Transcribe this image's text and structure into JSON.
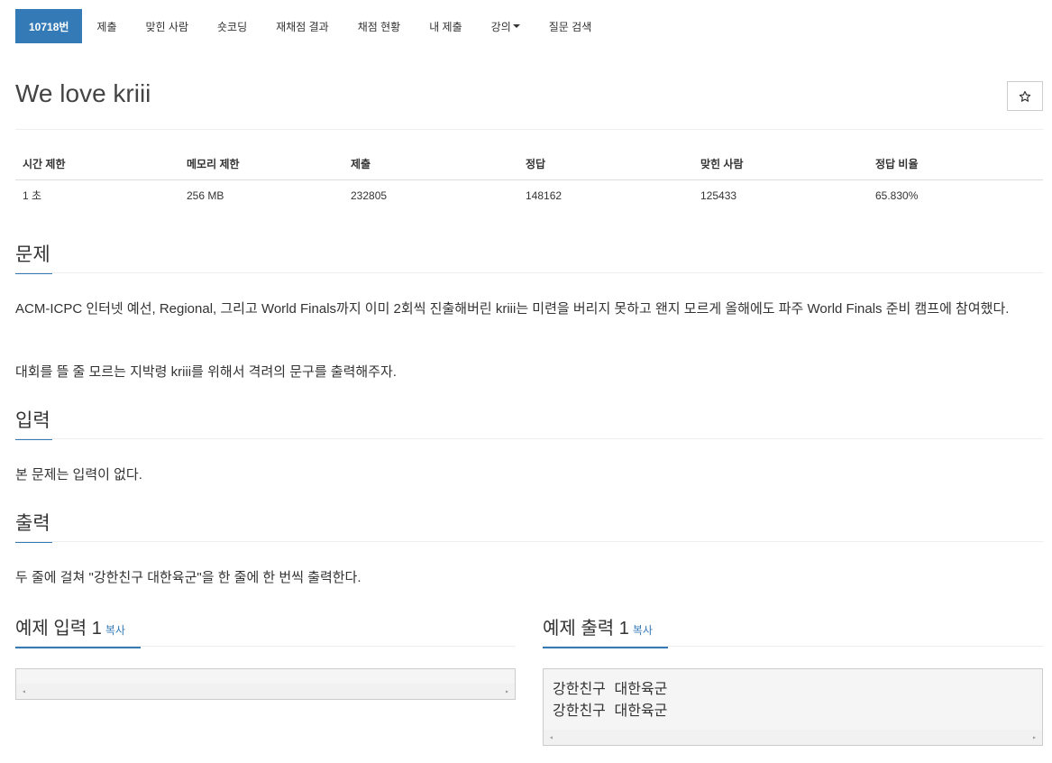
{
  "nav": {
    "items": [
      {
        "label": "10718번",
        "active": true
      },
      {
        "label": "제출"
      },
      {
        "label": "맞힌 사람"
      },
      {
        "label": "숏코딩"
      },
      {
        "label": "재채점 결과"
      },
      {
        "label": "채점 현황"
      },
      {
        "label": "내 제출"
      },
      {
        "label": "강의",
        "dropdown": true
      },
      {
        "label": "질문 검색"
      }
    ]
  },
  "problem": {
    "title": "We love kriii",
    "star_icon": "star-icon"
  },
  "info": {
    "headers": [
      "시간 제한",
      "메모리 제한",
      "제출",
      "정답",
      "맞힌 사람",
      "정답 비율"
    ],
    "values": [
      "1 초",
      "256 MB",
      "232805",
      "148162",
      "125433",
      "65.830%"
    ]
  },
  "sections": {
    "description": {
      "title": "문제",
      "paragraphs": [
        "ACM-ICPC 인터넷 예선, Regional, 그리고 World Finals까지 이미 2회씩 진출해버린 kriii는 미련을 버리지 못하고 왠지 모르게 올해에도 파주 World Finals 준비 캠프에 참여했다.",
        "대회를 뜰 줄 모르는 지박령 kriii를 위해서 격려의 문구를 출력해주자."
      ]
    },
    "input": {
      "title": "입력",
      "text": "본 문제는 입력이 없다."
    },
    "output": {
      "title": "출력",
      "text": "두 줄에 걸쳐 \"강한친구 대한육군\"을 한 줄에 한 번씩 출력한다."
    }
  },
  "samples": {
    "input": {
      "title": "예제 입력 1",
      "copy_label": "복사",
      "content": ""
    },
    "output": {
      "title": "예제 출력 1",
      "copy_label": "복사",
      "lines": [
        "강한친구 대한육군",
        "강한친구 대한육군"
      ]
    }
  },
  "colors": {
    "accent": "#337ab7",
    "pre_bg": "#f5f5f5"
  }
}
